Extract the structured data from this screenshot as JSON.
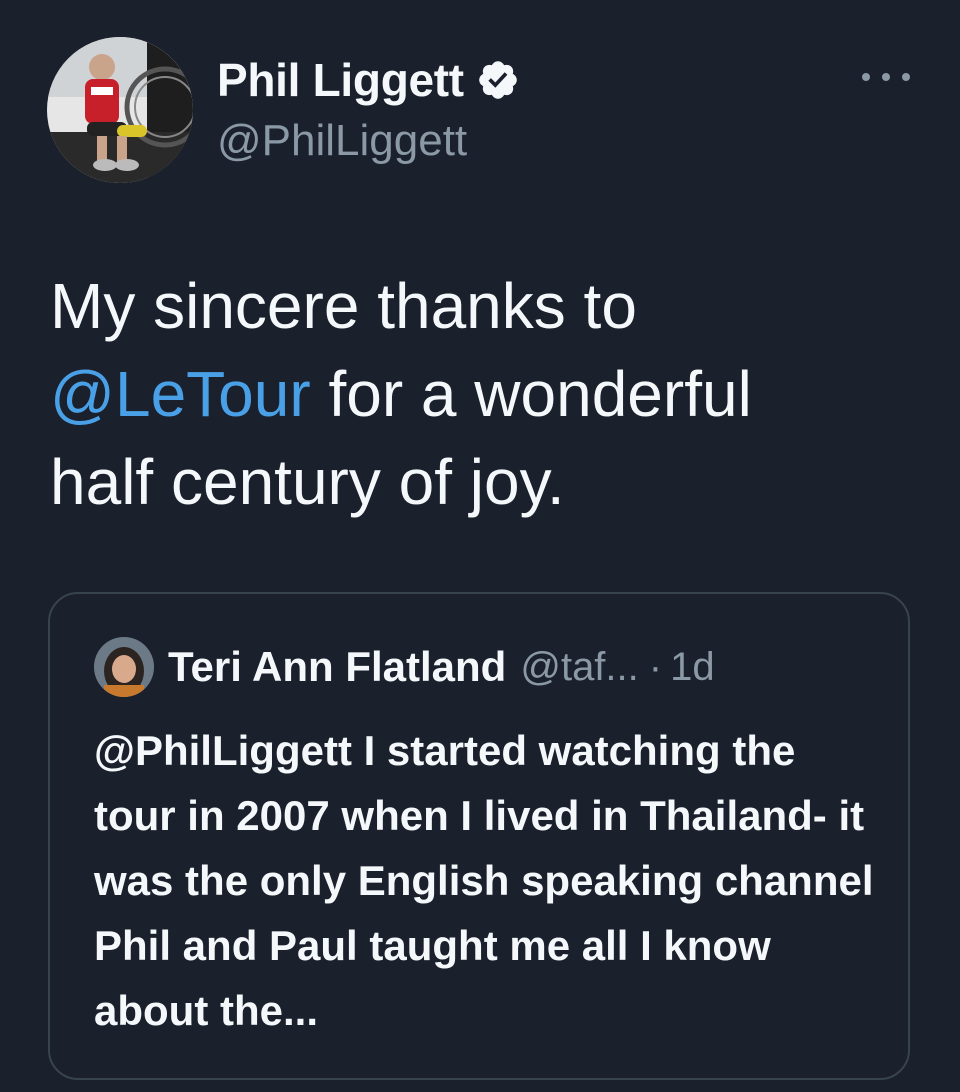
{
  "author": {
    "display_name": "Phil Liggett",
    "handle": "@PhilLiggett",
    "verified": true,
    "avatar_icon": "profile-photo-cyclist"
  },
  "menu": {
    "icon": "more-options-icon"
  },
  "tweet": {
    "line1": "My sincere thanks to",
    "mention": "@LeTour",
    "line2_rest": " for a wonderful",
    "line3": "half century of joy."
  },
  "quoted_tweet": {
    "author_name": "Teri Ann Flatland",
    "author_handle": "@taf...",
    "separator": "·",
    "time": "1d",
    "text": "@PhilLiggett I started watching the tour in 2007 when I lived in Thailand- it was the only English speaking channel Phil and Paul taught me all I know about the..."
  },
  "colors": {
    "background": "#1a202c",
    "text": "#f5f8fa",
    "secondary_text": "#8b98a5",
    "link": "#4aa0e6",
    "border": "#38444d"
  }
}
